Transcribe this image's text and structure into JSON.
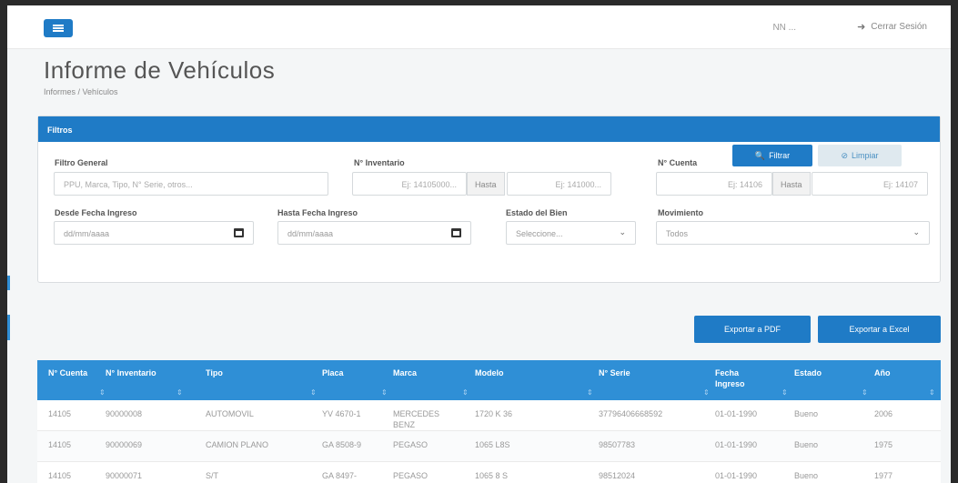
{
  "header": {
    "user": "NN ...",
    "logout_label": "Cerrar Sesión",
    "logout_icon": "sign-out-icon",
    "menu_icon": "hamburger-icon"
  },
  "page": {
    "title": "Informe de Vehículos",
    "breadcrumb": "Informes / Vehículos"
  },
  "filters": {
    "heading": "Filtros",
    "general_label": "Filtro General",
    "general_placeholder": "PPU, Marca, Tipo, N° Serie, otros...",
    "inventario_label": "N° Inventario",
    "inventario_from_placeholder": "Ej: 14105000...",
    "inventario_to_label": "Hasta",
    "inventario_to_placeholder": "Ej: 141000...",
    "cuenta_label": "N° Cuenta",
    "cuenta_from_placeholder": "Ej: 14106",
    "cuenta_to_label": "Hasta",
    "cuenta_to_placeholder": "Ej: 14107",
    "desde_label": "Desde Fecha Ingreso",
    "desde_placeholder": "dd/mm/aaaa",
    "hasta_label": "Hasta Fecha Ingreso",
    "hasta_placeholder": "dd/mm/aaaa",
    "estado_label": "Estado del Bien",
    "estado_value": "Seleccione...",
    "movimiento_label": "Movimiento",
    "movimiento_value": "Todos",
    "filter_button": "Filtrar",
    "clear_button": "Limpiar"
  },
  "actions": {
    "pdf": "Exportar a PDF",
    "excel": "Exportar a Excel"
  },
  "table": {
    "headers": [
      "N° Cuenta",
      "N° Inventario",
      "Tipo",
      "Placa",
      "Marca",
      "Modelo",
      "N° Serie",
      "Fecha Ingreso",
      "Estado",
      "Año"
    ],
    "rows": [
      [
        "14105",
        "90000008",
        "AUTOMOVIL",
        "YV 4670-1",
        "MERCEDES BENZ",
        "1720 K 36",
        "37796406668592",
        "01-01-1990",
        "Bueno",
        "2006"
      ],
      [
        "14105",
        "90000069",
        "CAMION PLANO",
        "GA 8508-9",
        "PEGASO",
        "1065 L8S",
        "98507783",
        "01-01-1990",
        "Bueno",
        "1975"
      ],
      [
        "14105",
        "90000071",
        "S/T",
        "GA 8497-",
        "PEGASO",
        "1065 8 S",
        "98512024",
        "01-01-1990",
        "Bueno",
        "1977"
      ]
    ]
  },
  "colors": {
    "primary": "#1f7bc6",
    "table_header": "#2f8fd6"
  }
}
